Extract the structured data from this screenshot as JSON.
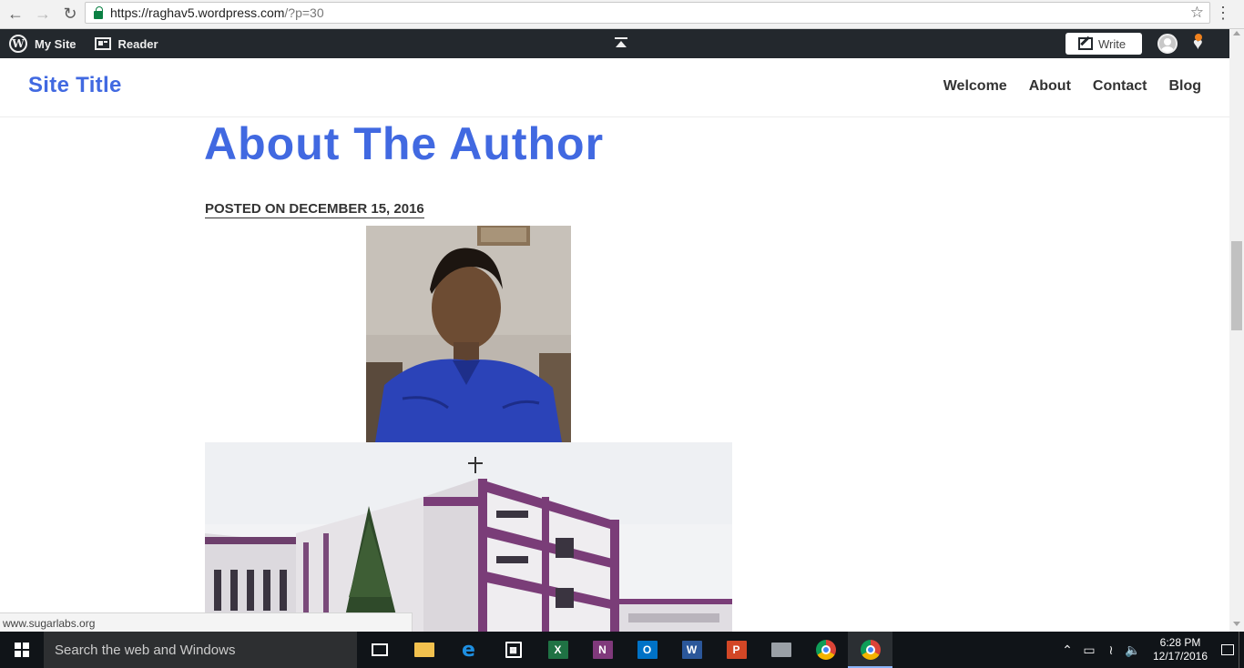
{
  "browser": {
    "url_host": "https://raghav5.wordpress.com",
    "url_path": "/?p=30"
  },
  "admin_bar": {
    "my_site": "My Site",
    "reader": "Reader",
    "write": "Write"
  },
  "site": {
    "title": "Site Title",
    "nav": [
      "Welcome",
      "About",
      "Contact",
      "Blog"
    ]
  },
  "post": {
    "title": "About The Author",
    "posted_on_label": "POSTED ON",
    "date": "DECEMBER 15, 2016"
  },
  "status_bar": {
    "url": "www.sugarlabs.org"
  },
  "taskbar": {
    "search_placeholder": "Search the web and Windows",
    "time": "6:28 PM",
    "date": "12/17/2016",
    "apps": [
      "task-view",
      "file-explorer",
      "edge",
      "store",
      "excel",
      "onenote",
      "outlook",
      "word",
      "powerpoint",
      "app",
      "chrome",
      "chrome-active"
    ]
  },
  "colors": {
    "accent": "#4169e1",
    "admin_bar": "#23282d",
    "taskbar": "#101418"
  }
}
